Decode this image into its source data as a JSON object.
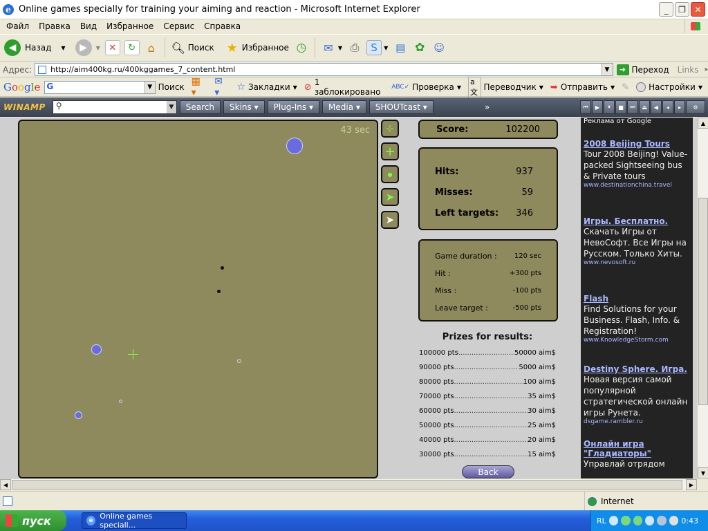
{
  "window": {
    "title": "Online games specially for training your aiming and reaction - Microsoft Internet Explorer"
  },
  "menu": [
    "Файл",
    "Правка",
    "Вид",
    "Избранное",
    "Сервис",
    "Справка"
  ],
  "toolbar": {
    "back_label": "Назад",
    "search_label": "Поиск",
    "favorites_label": "Избранное"
  },
  "address": {
    "label": "Адрес:",
    "url": "http://aim400kg.ru/400kggames_7_content.html",
    "go_label": "Переход",
    "links_label": "Links"
  },
  "googlebar": {
    "logo": [
      "G",
      "o",
      "o",
      "g",
      "l",
      "e"
    ],
    "search_label": "Поиск",
    "bookmarks_label": "Закладки",
    "blocked_label": "1 заблокировано",
    "check_label": "Проверка",
    "translate_label": "Переводчик",
    "send_label": "Отправить",
    "settings_label": "Настройки"
  },
  "winamp": {
    "logo": "WINAMP",
    "search_button": "Search",
    "skins": "Skins",
    "plugins": "Plug-Ins",
    "media": "Media",
    "shoutcast": "SHOUTcast"
  },
  "game": {
    "timer": "43 sec",
    "score_label": "Score:",
    "score_value": "102200",
    "stats": [
      {
        "label": "Hits:",
        "value": "937"
      },
      {
        "label": "Misses:",
        "value": "59"
      },
      {
        "label": "Left targets:",
        "value": "346"
      }
    ],
    "rules": [
      {
        "label": "Game duration :",
        "value": "120 sec"
      },
      {
        "label": "Hit :",
        "value": "+300 pts"
      },
      {
        "label": "Miss :",
        "value": "-100 pts"
      },
      {
        "label": "Leave target :",
        "value": "-500 pts"
      }
    ],
    "prizes_title": "Prizes for results:",
    "prizes": [
      {
        "pts": "100000 pts",
        "aim": "50000 aim$"
      },
      {
        "pts": "90000 pts",
        "aim": "5000 aim$"
      },
      {
        "pts": "80000 pts",
        "aim": "100 aim$"
      },
      {
        "pts": "70000 pts",
        "aim": "35 aim$"
      },
      {
        "pts": "60000 pts",
        "aim": "30 aim$"
      },
      {
        "pts": "50000 pts",
        "aim": "25 aim$"
      },
      {
        "pts": "40000 pts",
        "aim": "20 aim$"
      },
      {
        "pts": "30000 pts",
        "aim": "15 aim$"
      }
    ],
    "back_label": "Back"
  },
  "ads": {
    "header": "Реклама от Google",
    "items": [
      {
        "title": "2008 Beijing Tours",
        "desc": "Tour 2008 Beijing! Value-packed Sightseeing bus & Private tours",
        "url": "www.destinationchina.travel"
      },
      {
        "title": "Игры. Бесплатно.",
        "desc": "Скачать Игры от НевоСофт. Все Игры на Русском. Только Хиты.",
        "url": "www.nevosoft.ru"
      },
      {
        "title": "Flash",
        "desc": "Find Solutions for your Business. Flash, Info. & Registration!",
        "url": "www.KnowledgeStorm.com"
      },
      {
        "title": "Destiny Sphere. Игра.",
        "desc": "Новая версия самой популярной стратегической онлайн игры Рунета.",
        "url": "dsgame.rambler.ru"
      },
      {
        "title": "Онлайн игра \"Гладиаторы\"",
        "desc": "Управлай отрядом",
        "url": ""
      }
    ]
  },
  "status": {
    "zone": "Internet"
  },
  "taskbar": {
    "start": "пуск",
    "task": "Online games speciall...",
    "lang": "RL",
    "clock": "0:43"
  }
}
